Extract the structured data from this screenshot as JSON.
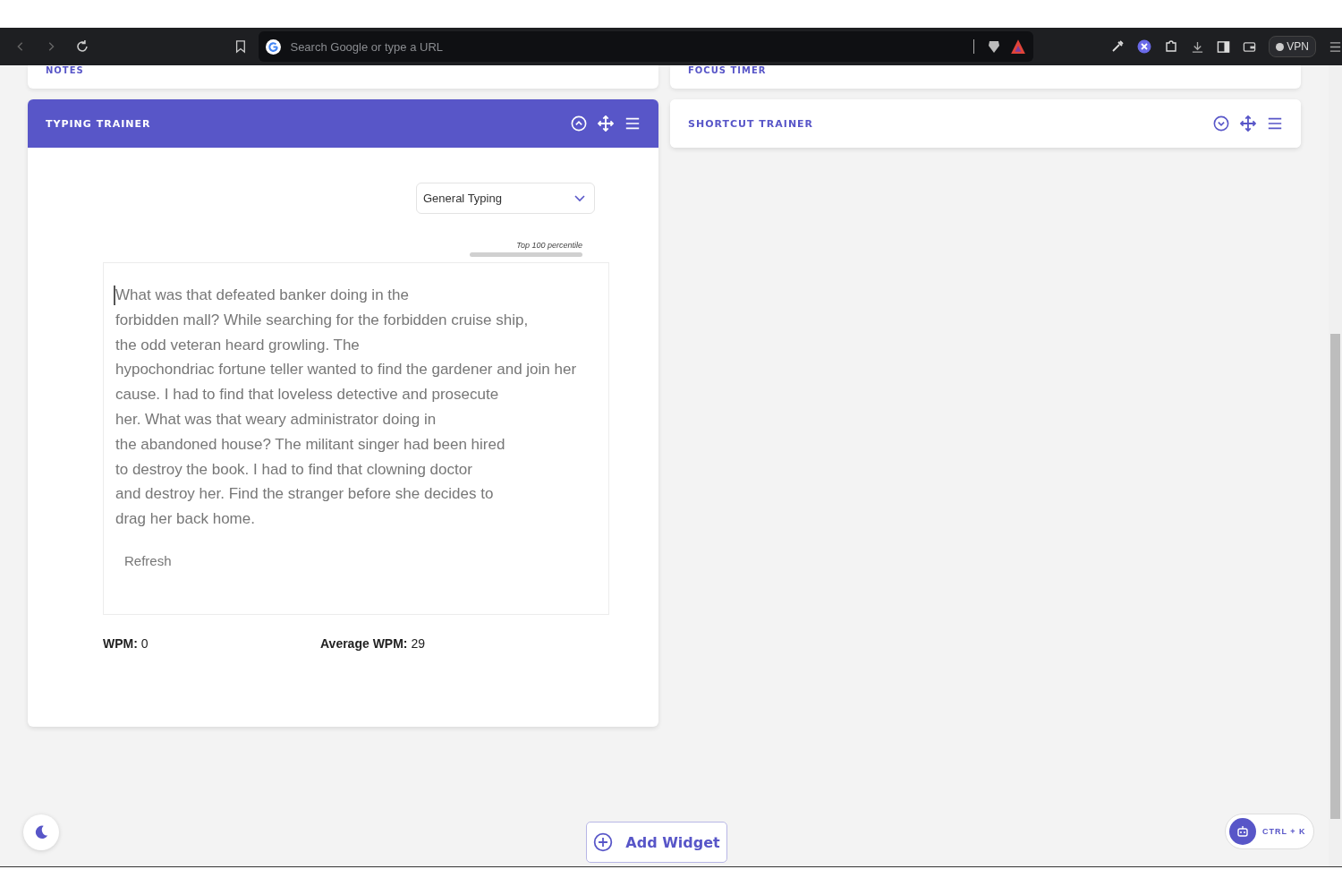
{
  "browser": {
    "address_placeholder": "Search Google or type a URL",
    "vpn_label": "VPN"
  },
  "columns": [
    {
      "peek_card": {
        "title": "NOTES"
      },
      "widget": {
        "kind": "typing",
        "title": "TYPING TRAINER",
        "expanded": true,
        "mode": "General Typing",
        "percentile": {
          "label": "Top 100 percentile",
          "level": 0
        },
        "text_lines": [
          "What was that defeated banker doing in the",
          "forbidden mall? While searching for the forbidden cruise ship,",
          "the odd veteran heard growling. The",
          "hypochondriac fortune teller wanted to find the gardener and join her",
          "cause. I had to find that loveless detective and prosecute",
          "her. What was that weary administrator doing in",
          "the abandoned house? The militant singer had been hired",
          "to destroy the book. I had to find that clowning doctor",
          "and destroy her. Find the stranger before she decides to",
          "drag her back home."
        ],
        "refresh": "Refresh",
        "wpm": "**WPM:** 0",
        "average_wpm": "**Average WPM:** 29"
      }
    },
    {
      "peek_card": {
        "title": "FOCUS TIMER"
      },
      "widget": {
        "kind": "collapsed",
        "title": "SHORTCUT TRAINER",
        "expanded": false
      }
    }
  ],
  "add_widget": "Add Widget",
  "assistant_shortcut": "CTRL + K"
}
